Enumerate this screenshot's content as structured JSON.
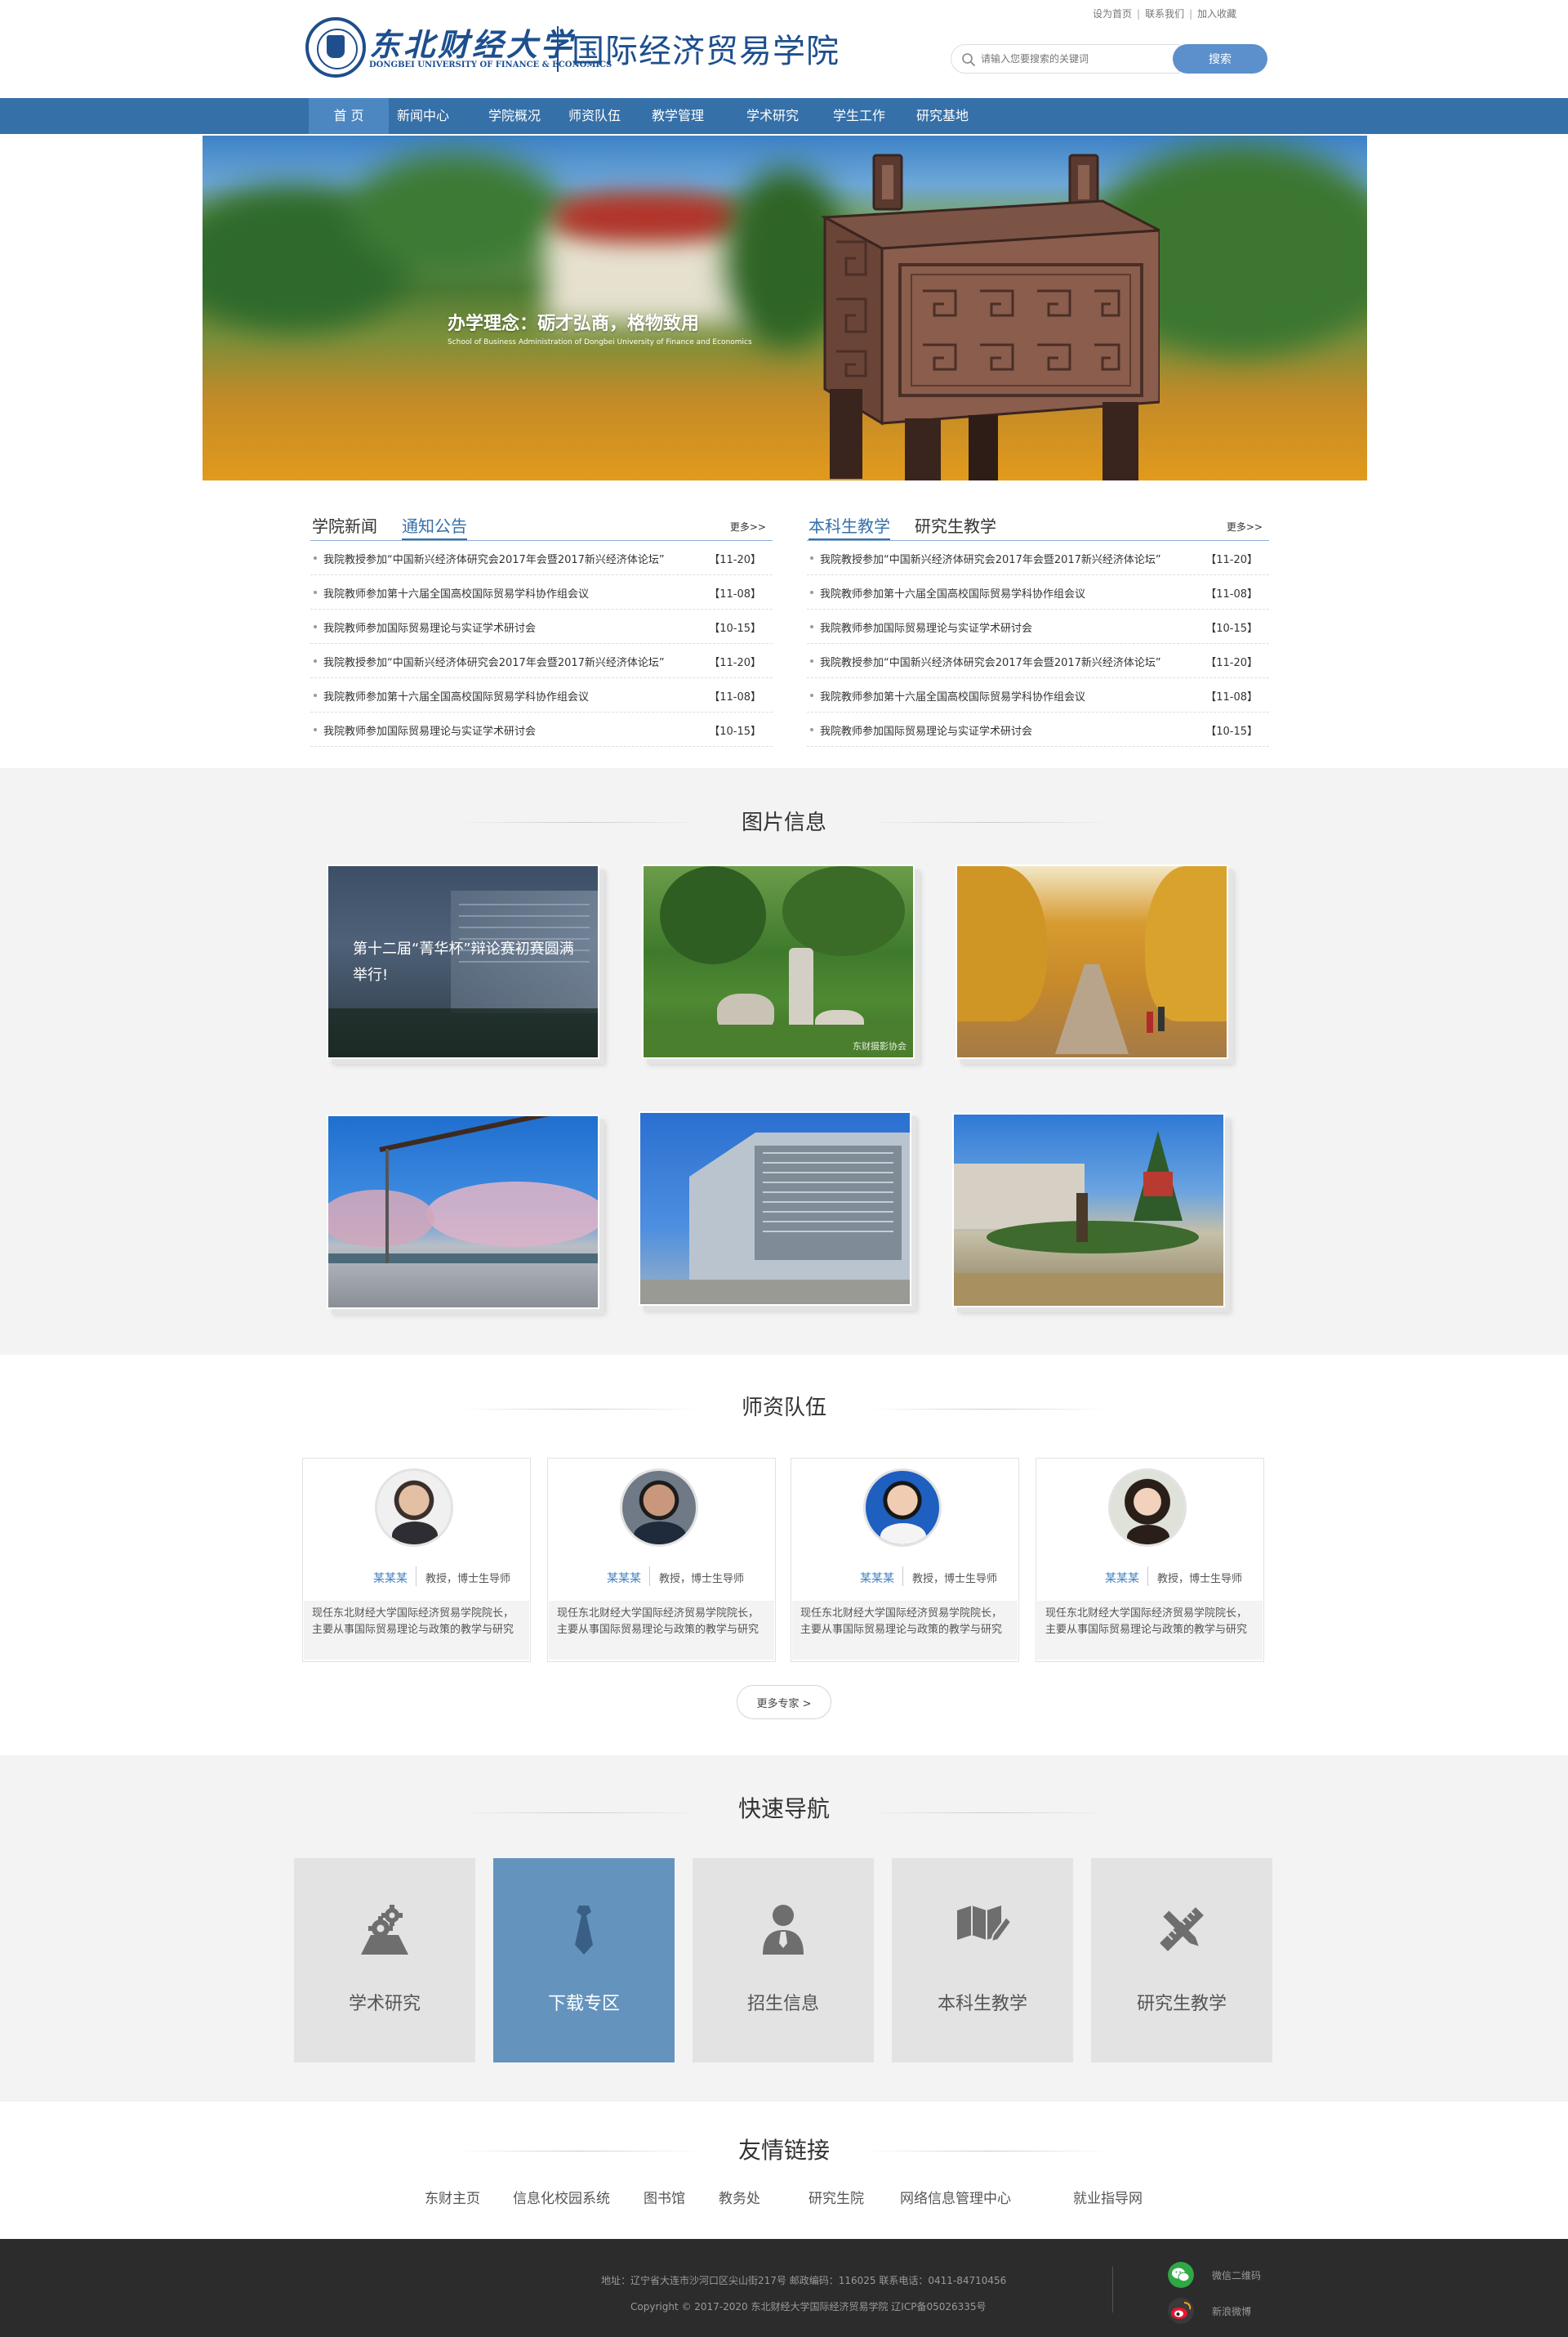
{
  "header": {
    "logo_cn": "东北财经大学",
    "logo_en": "DONGBEI UNIVERSITY OF FINANCE & ECONOMICS",
    "college_name": "国际经济贸易学院",
    "toplinks": [
      "设为首页",
      "联系我们",
      "加入收藏"
    ],
    "search_placeholder": "请输入您要搜索的关键词",
    "search_button": "搜索"
  },
  "nav": {
    "items": [
      "首 页",
      "新闻中心",
      "学院概况",
      "师资队伍",
      "教学管理",
      "学术研究",
      "学生工作",
      "研究基地"
    ],
    "active_index": 0
  },
  "banner": {
    "title": "办学理念：砺才弘商，格物致用",
    "subtitle": "School of Business Administration of Dongbei University of Finance and Economics"
  },
  "news_left": {
    "tabs": [
      "学院新闻",
      "通知公告"
    ],
    "active_tab": 1,
    "more": "更多>>",
    "items": [
      {
        "title": "我院教授参加“中国新兴经济体研究会2017年会暨2017新兴经济体论坛”",
        "date": "【11-20】"
      },
      {
        "title": "我院教师参加第十六届全国高校国际贸易学科协作组会议",
        "date": "【11-08】"
      },
      {
        "title": "我院教师参加国际贸易理论与实证学术研讨会",
        "date": "【10-15】"
      },
      {
        "title": "我院教授参加“中国新兴经济体研究会2017年会暨2017新兴经济体论坛”",
        "date": "【11-20】"
      },
      {
        "title": "我院教师参加第十六届全国高校国际贸易学科协作组会议",
        "date": "【11-08】"
      },
      {
        "title": "我院教师参加国际贸易理论与实证学术研讨会",
        "date": "【10-15】"
      }
    ]
  },
  "news_right": {
    "tabs": [
      "本科生教学",
      "研究生教学"
    ],
    "active_tab": 0,
    "more": "更多>>",
    "items": [
      {
        "title": "我院教授参加“中国新兴经济体研究会2017年会暨2017新兴经济体论坛”",
        "date": "【11-20】"
      },
      {
        "title": "我院教师参加第十六届全国高校国际贸易学科协作组会议",
        "date": "【11-08】"
      },
      {
        "title": "我院教师参加国际贸易理论与实证学术研讨会",
        "date": "【10-15】"
      },
      {
        "title": "我院教授参加“中国新兴经济体研究会2017年会暨2017新兴经济体论坛”",
        "date": "【11-20】"
      },
      {
        "title": "我院教师参加第十六届全国高校国际贸易学科协作组会议",
        "date": "【11-08】"
      },
      {
        "title": "我院教师参加国际贸易理论与实证学术研讨会",
        "date": "【10-15】"
      }
    ]
  },
  "photos": {
    "title": "图片信息",
    "first_caption": "第十二届“菁华杯”辩论赛初赛圆满举行!",
    "second_credit": "东财摄影协会"
  },
  "faculty": {
    "title": "师资队伍",
    "teachers": [
      {
        "name": "某某某",
        "title": "教授，博士生导师",
        "bio": "现任东北财经大学国际经济贸易学院院长，主要从事国际贸易理论与政策的教学与研究"
      },
      {
        "name": "某某某",
        "title": "教授，博士生导师",
        "bio": "现任东北财经大学国际经济贸易学院院长，主要从事国际贸易理论与政策的教学与研究"
      },
      {
        "name": "某某某",
        "title": "教授，博士生导师",
        "bio": "现任东北财经大学国际经济贸易学院院长，主要从事国际贸易理论与政策的教学与研究"
      },
      {
        "name": "某某某",
        "title": "教授，博士生导师",
        "bio": "现任东北财经大学国际经济贸易学院院长，主要从事国际贸易理论与政策的教学与研究"
      }
    ],
    "more": "更多专家 >"
  },
  "quicknav": {
    "title": "快速导航",
    "items": [
      {
        "label": "学术研究",
        "icon": "research-gears-icon"
      },
      {
        "label": "下载专区",
        "icon": "necktie-download-icon"
      },
      {
        "label": "招生信息",
        "icon": "person-icon"
      },
      {
        "label": "本科生教学",
        "icon": "map-pencil-icon"
      },
      {
        "label": "研究生教学",
        "icon": "ruler-pencil-icon"
      }
    ],
    "active_index": 1
  },
  "links": {
    "title": "友情链接",
    "items": [
      "东财主页",
      "信息化校园系统",
      "图书馆",
      "教务处",
      "研究生院",
      "网络信息管理中心",
      "就业指导网"
    ]
  },
  "footer": {
    "address": "地址：辽宁省大连市沙河口区尖山街217号  邮政编码：116025  联系电话：0411-84710456",
    "copyright": "Copyright © 2017-2020  东北财经大学国际经济贸易学院    辽ICP备05026335号",
    "wechat": "微信二维码",
    "weibo": "新浪微博"
  },
  "colors": {
    "nav_blue": "#3670a8",
    "accent_blue": "#3e7fc2",
    "quicknav_active": "#6493bd",
    "footer_bg": "#2c2c2c"
  }
}
